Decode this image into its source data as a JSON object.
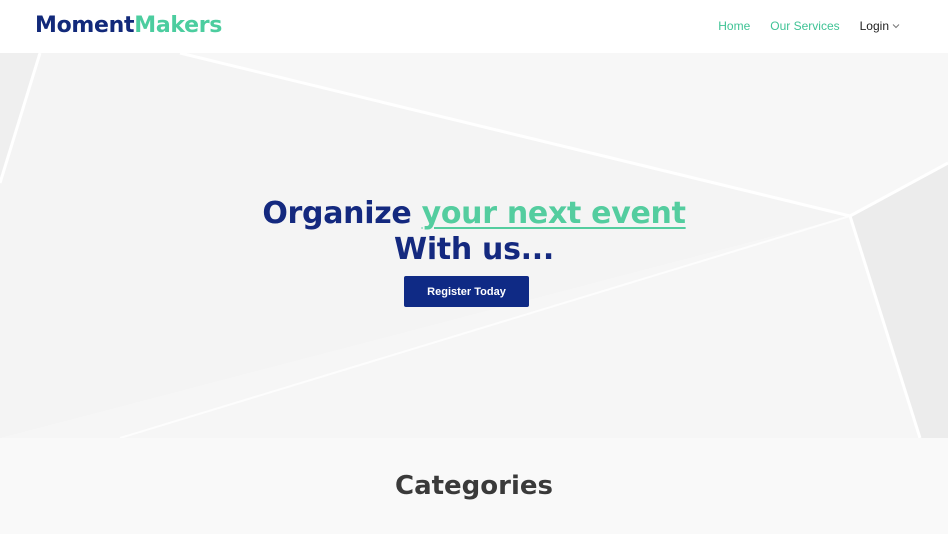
{
  "brand": {
    "part1": "Moment",
    "part2": "Makers"
  },
  "nav": {
    "home": "Home",
    "services": "Our Services",
    "login": "Login"
  },
  "hero": {
    "headline_lead": "Organize ",
    "headline_accent": "your next event",
    "headline_line2": "With us...",
    "cta_label": "Register Today"
  },
  "categories": {
    "title": "Categories"
  },
  "colors": {
    "brand_navy": "#12297a",
    "brand_green": "#4ccd9f",
    "button_bg": "#0f2a85"
  }
}
